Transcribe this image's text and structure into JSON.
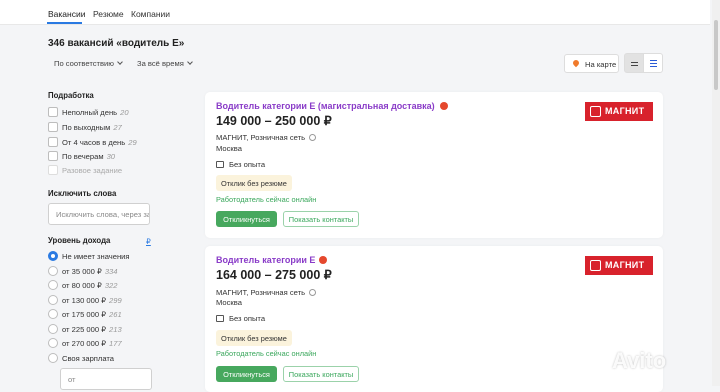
{
  "nav": {
    "tabs": [
      {
        "label": "Вакансии"
      },
      {
        "label": "Резюме"
      },
      {
        "label": "Компании"
      }
    ]
  },
  "header": {
    "title": "346 вакансий «водитель Е»"
  },
  "sort": {
    "order_label": "По соответствию",
    "period_label": "За всё время"
  },
  "view": {
    "map_label": "На карте"
  },
  "filters": {
    "parttime": {
      "heading": "Подработка",
      "items": [
        {
          "label": "Неполный день",
          "count": "20"
        },
        {
          "label": "По выходным",
          "count": "27"
        },
        {
          "label": "От 4 часов в день",
          "count": "29"
        },
        {
          "label": "По вечерам",
          "count": "30"
        },
        {
          "label": "Разовое задание",
          "count": ""
        }
      ]
    },
    "exclude": {
      "heading": "Исключить слова",
      "placeholder": "Исключить слова, через за"
    },
    "income": {
      "heading": "Уровень дохода",
      "currency": "₽",
      "items": [
        {
          "label": "Не имеет значения",
          "count": ""
        },
        {
          "label": "от 35 000 ₽",
          "count": "334"
        },
        {
          "label": "от 80 000 ₽",
          "count": "322"
        },
        {
          "label": "от 130 000 ₽",
          "count": "299"
        },
        {
          "label": "от 175 000 ₽",
          "count": "261"
        },
        {
          "label": "от 225 000 ₽",
          "count": "213"
        },
        {
          "label": "от 270 000 ₽",
          "count": "177"
        },
        {
          "label": "Своя зарплата",
          "count": ""
        }
      ],
      "from_placeholder": "от"
    }
  },
  "vacancies": [
    {
      "title": "Водитель категории Е (магистральная доставка)",
      "salary": "149 000 – 250 000 ₽",
      "company": "МАГНИТ, Розничная сеть",
      "city": "Москва",
      "experience": "Без опыта",
      "tag": "Отклик без резюме",
      "online": "Работодатель сейчас онлайн",
      "apply_label": "Откликнуться",
      "contacts_label": "Показать контакты",
      "logo_text": "МАГНИТ"
    },
    {
      "title": "Водитель категории Е",
      "salary": "164 000 – 275 000 ₽",
      "company": "МАГНИТ, Розничная сеть",
      "city": "Москва",
      "experience": "Без опыта",
      "tag": "Отклик без резюме",
      "online": "Работодатель сейчас онлайн",
      "apply_label": "Откликнуться",
      "contacts_label": "Показать контакты",
      "logo_text": "МАГНИТ"
    }
  ],
  "watermark": "Avito",
  "colors": {
    "accent": "#2a7ae2",
    "vacancy_title": "#8a3cc8",
    "apply": "#47a85e",
    "online": "#3aa75c",
    "magnit": "#d8222c"
  }
}
